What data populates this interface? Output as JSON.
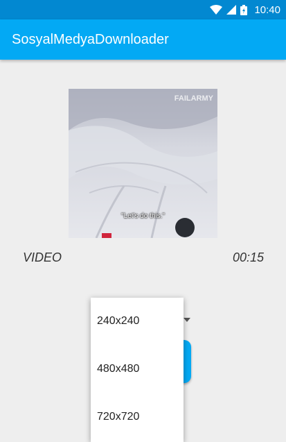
{
  "status_bar": {
    "time": "10:40",
    "icons": [
      "wifi-icon",
      "cell-signal-icon",
      "battery-icon"
    ]
  },
  "app_bar": {
    "title": "SosyalMedyaDownloader"
  },
  "thumbnail": {
    "watermark": "FAILARMY",
    "subtitle": "\"Let's do this.\""
  },
  "media": {
    "type": "VIDEO",
    "duration": "00:15"
  },
  "resolution_dropdown": {
    "options": [
      "240x240",
      "480x480",
      "720x720"
    ]
  },
  "colors": {
    "status_bar": "#0288d1",
    "app_bar": "#03a9f4",
    "background": "#eeeeee",
    "accent": "#03a9f4"
  }
}
